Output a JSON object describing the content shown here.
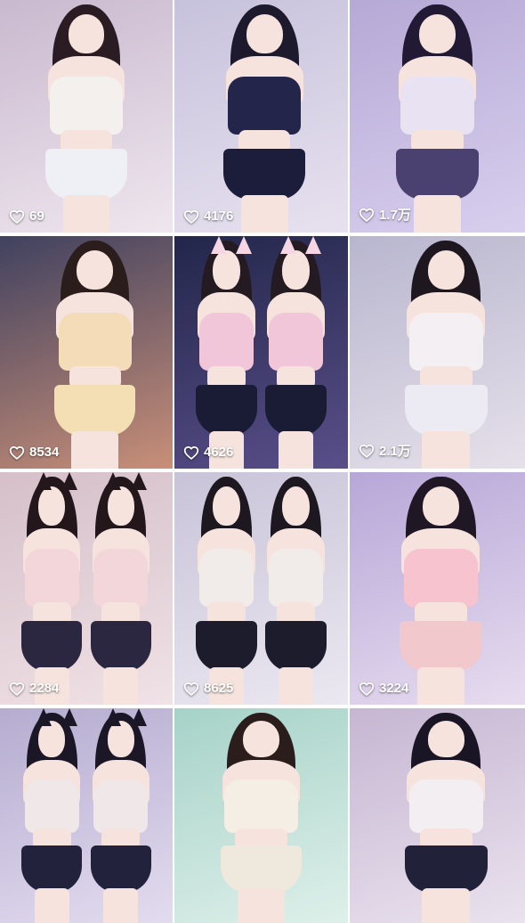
{
  "feed": {
    "items": [
      {
        "likes": "69",
        "bg": [
          "#c9b9cf",
          "#efe6ee"
        ],
        "hair": "#2a1c22",
        "top": "#f4f0ee",
        "skirt": "#eef0f6"
      },
      {
        "likes": "4176",
        "bg": [
          "#c7c2dc",
          "#e7e1ef"
        ],
        "hair": "#1e1a2e",
        "top": "#23254a",
        "skirt": "#1c1d3a"
      },
      {
        "likes": "1.7万",
        "bg": [
          "#b6a9d6",
          "#d8cfee"
        ],
        "hair": "#221a34",
        "top": "#e8e2f2",
        "skirt": "#4a4170"
      },
      {
        "likes": "8534",
        "bg": [
          "#40415f",
          "#c98f78"
        ],
        "hair": "#2b1d1c",
        "top": "#f5dcb8",
        "skirt": "#f4dfb5"
      },
      {
        "likes": "4626",
        "bg": [
          "#22264a",
          "#5a4f8a"
        ],
        "hair": "#231a22",
        "top": "#f1c6d8",
        "skirt": "#1a1b34"
      },
      {
        "likes": "2.1万",
        "bg": [
          "#b8b6cf",
          "#e6e0ea"
        ],
        "hair": "#1f1720",
        "top": "#f3eff2",
        "skirt": "#ecebf3"
      },
      {
        "likes": "2284",
        "bg": [
          "#d5bfc9",
          "#f0e2e6"
        ],
        "hair": "#24171b",
        "top": "#f3d6da",
        "skirt": "#2b2740"
      },
      {
        "likes": "8625",
        "bg": [
          "#c8c3d8",
          "#ece8f1"
        ],
        "hair": "#1d1820",
        "top": "#f1ece9",
        "skirt": "#1c1c2c"
      },
      {
        "likes": "3224",
        "bg": [
          "#b7a7d8",
          "#e7dcef"
        ],
        "hair": "#1f1724",
        "top": "#f6c3cf",
        "skirt": "#f1c8cc"
      },
      {
        "likes": "",
        "bg": [
          "#b5acd0",
          "#e3dcef"
        ],
        "hair": "#1b1726",
        "top": "#efe7e8",
        "skirt": "#23223c"
      },
      {
        "likes": "",
        "bg": [
          "#a6d2c8",
          "#def0ea"
        ],
        "hair": "#2a1d1c",
        "top": "#f4eee5",
        "skirt": "#efe8dd"
      },
      {
        "likes": "",
        "bg": [
          "#c6b6d2",
          "#eae2ee"
        ],
        "hair": "#1a1524",
        "top": "#f3eef2",
        "skirt": "#22213a"
      }
    ]
  },
  "icons": {
    "like": "heart-outline-icon"
  },
  "colors": {
    "like_text": "#ffffff",
    "separator": "#ffffff"
  }
}
